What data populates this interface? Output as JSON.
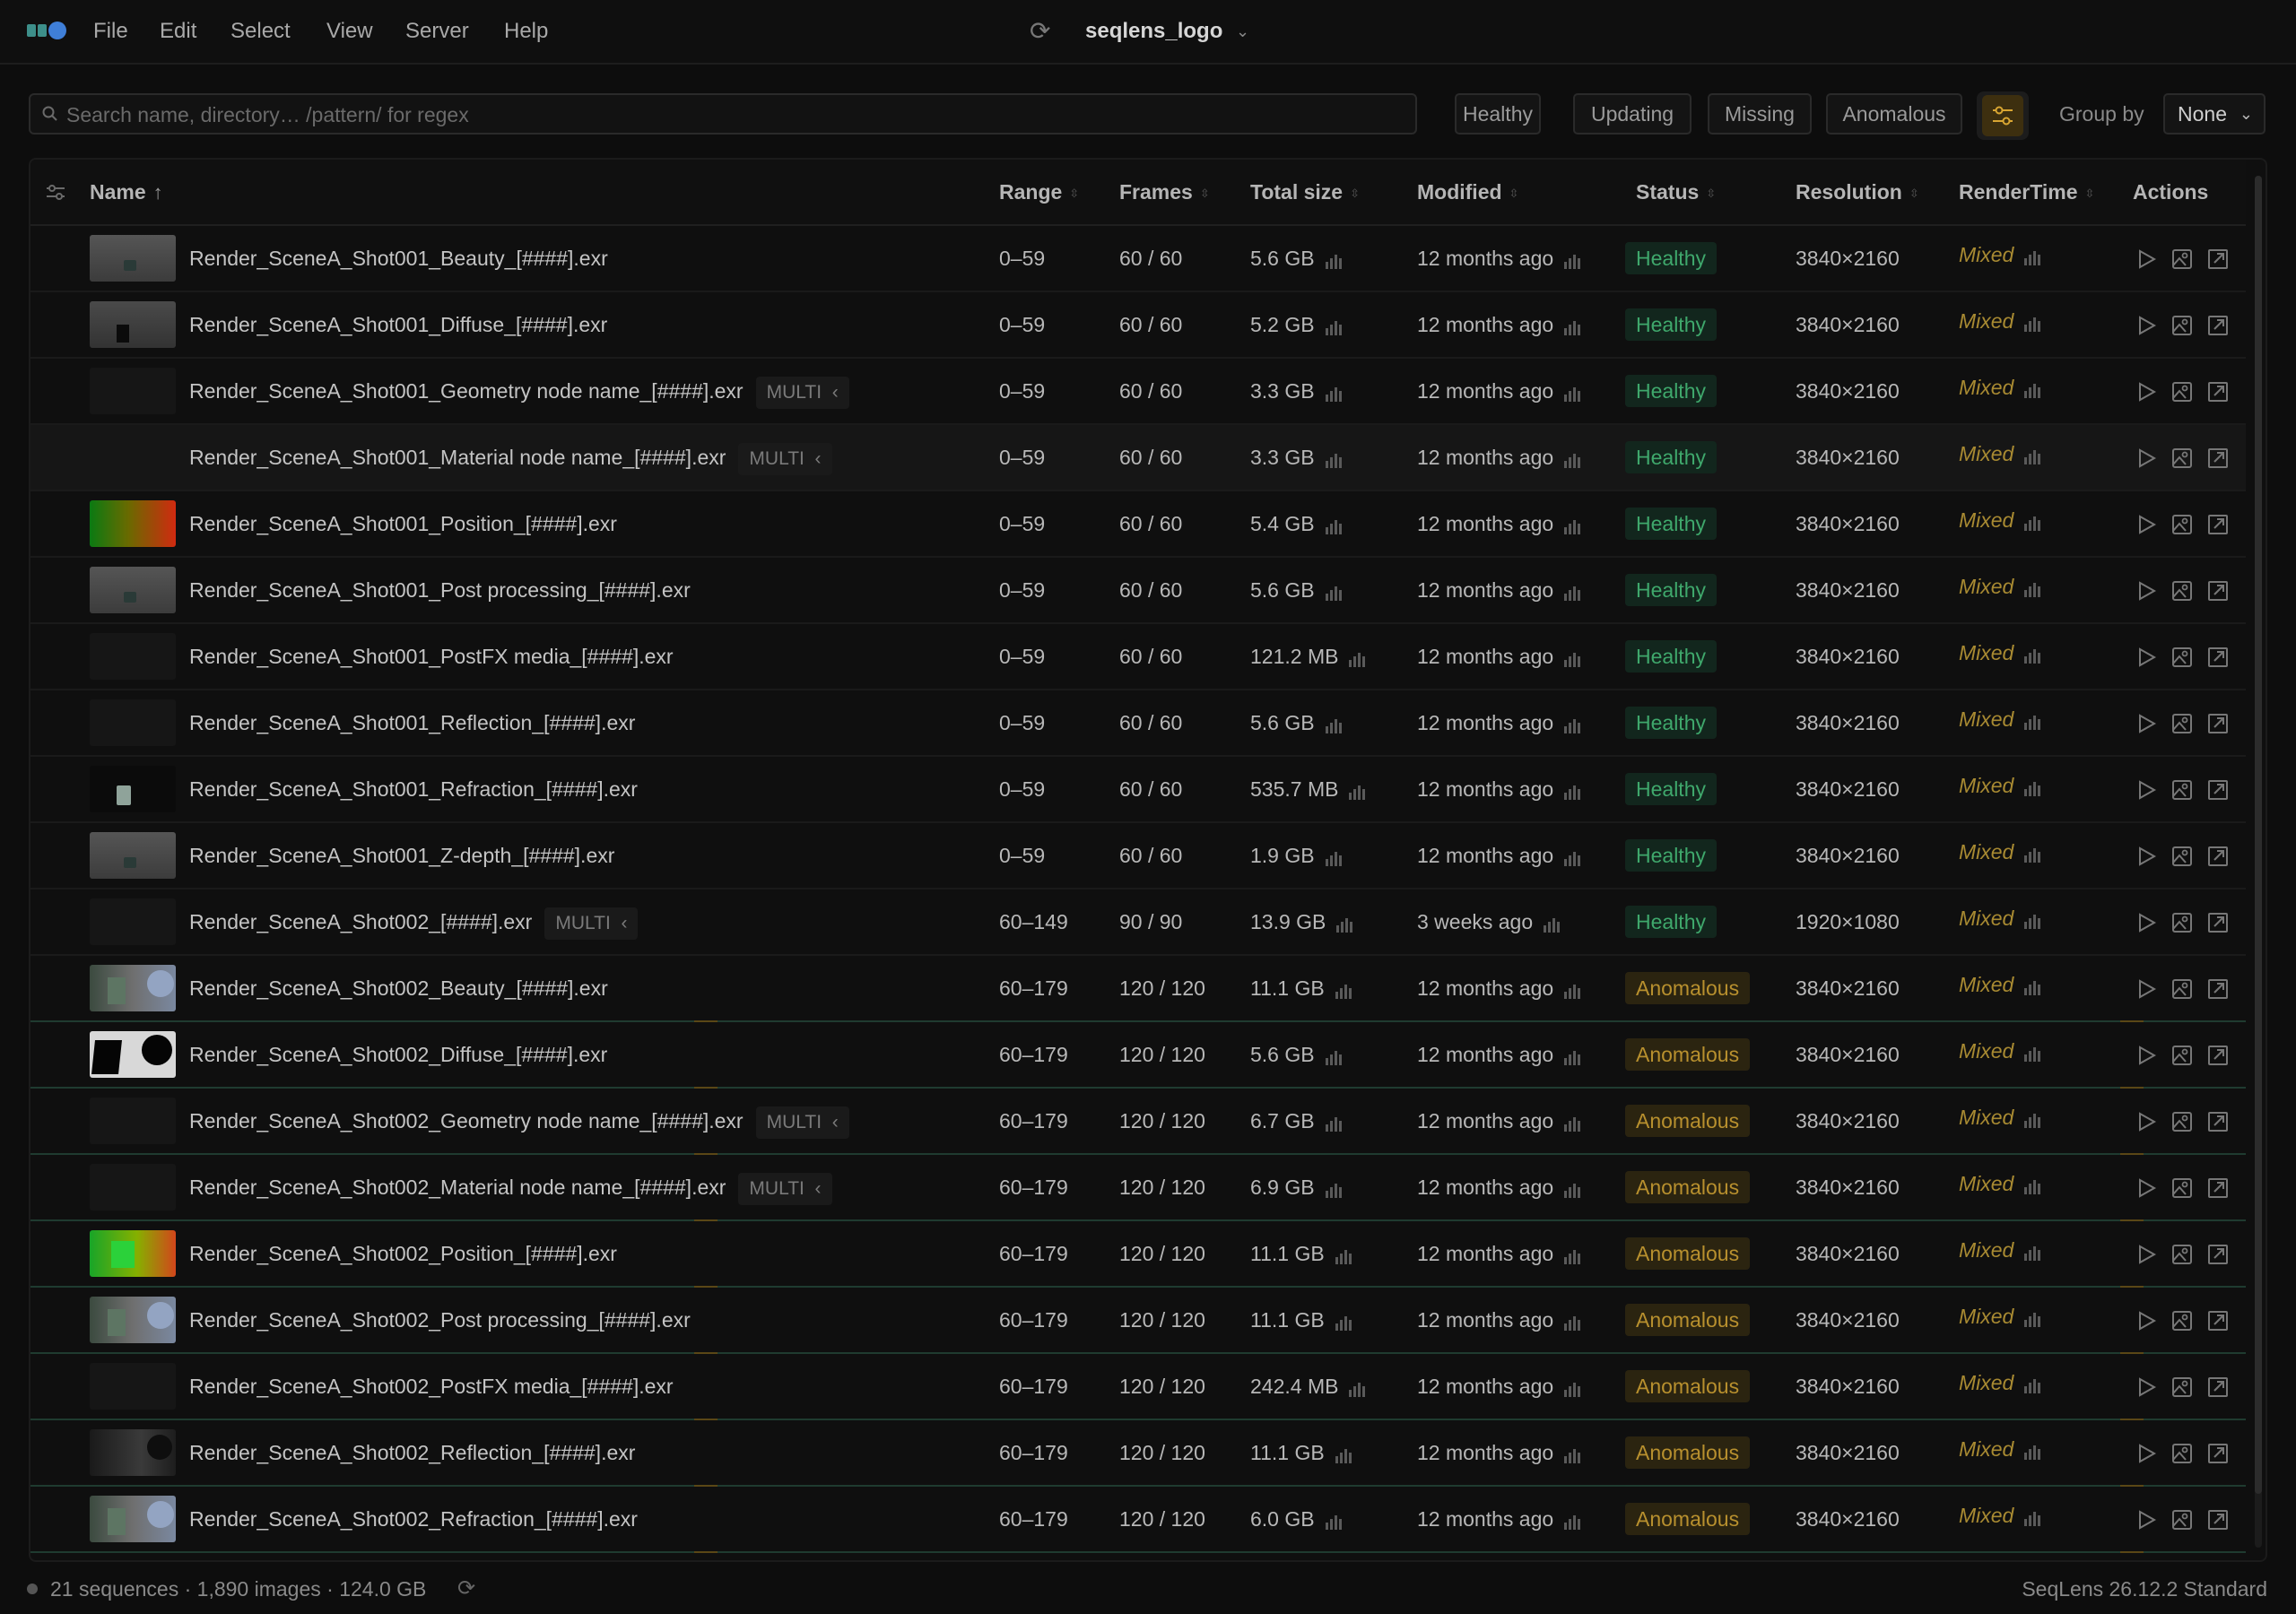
{
  "app": {
    "menu": [
      "File",
      "Edit",
      "Select",
      "View",
      "Server",
      "Help"
    ],
    "project_name": "seqlens_logo"
  },
  "toolbar": {
    "search_placeholder": "Search name, directory… /pattern/ for regex",
    "filters": [
      "Healthy",
      "Updating",
      "Missing",
      "Anomalous"
    ],
    "group_by_label": "Group by",
    "group_by_value": "None"
  },
  "table": {
    "columns": [
      "Name",
      "Range",
      "Frames",
      "Total size",
      "Modified",
      "Status",
      "Resolution",
      "RenderTime",
      "Actions"
    ],
    "rows": [
      {
        "name": "Render_SceneA_Shot001_Beauty_[####].exr",
        "multi": "",
        "range": "0–59",
        "frames": "60 / 60",
        "size": "5.6 GB",
        "modified": "12 months ago",
        "status": "Healthy",
        "resolution": "3840×2160",
        "rendertime": "Mixed",
        "thumb": "grey"
      },
      {
        "name": "Render_SceneA_Shot001_Diffuse_[####].exr",
        "multi": "",
        "range": "0–59",
        "frames": "60 / 60",
        "size": "5.2 GB",
        "modified": "12 months ago",
        "status": "Healthy",
        "resolution": "3840×2160",
        "rendertime": "Mixed",
        "thumb": "grey-dark"
      },
      {
        "name": "Render_SceneA_Shot001_Geometry node name_[####].exr",
        "multi": "MULTI",
        "range": "0–59",
        "frames": "60 / 60",
        "size": "3.3 GB",
        "modified": "12 months ago",
        "status": "Healthy",
        "resolution": "3840×2160",
        "rendertime": "Mixed",
        "thumb": "black"
      },
      {
        "name": "Render_SceneA_Shot001_Material node name_[####].exr",
        "multi": "MULTI",
        "range": "0–59",
        "frames": "60 / 60",
        "size": "3.3 GB",
        "modified": "12 months ago",
        "status": "Healthy",
        "resolution": "3840×2160",
        "rendertime": "Mixed",
        "thumb": "black"
      },
      {
        "name": "Render_SceneA_Shot001_Position_[####].exr",
        "multi": "",
        "range": "0–59",
        "frames": "60 / 60",
        "size": "5.4 GB",
        "modified": "12 months ago",
        "status": "Healthy",
        "resolution": "3840×2160",
        "rendertime": "Mixed",
        "thumb": "position"
      },
      {
        "name": "Render_SceneA_Shot001_Post processing_[####].exr",
        "multi": "",
        "range": "0–59",
        "frames": "60 / 60",
        "size": "5.6 GB",
        "modified": "12 months ago",
        "status": "Healthy",
        "resolution": "3840×2160",
        "rendertime": "Mixed",
        "thumb": "grey"
      },
      {
        "name": "Render_SceneA_Shot001_PostFX media_[####].exr",
        "multi": "",
        "range": "0–59",
        "frames": "60 / 60",
        "size": "121.2 MB",
        "modified": "12 months ago",
        "status": "Healthy",
        "resolution": "3840×2160",
        "rendertime": "Mixed",
        "thumb": "black"
      },
      {
        "name": "Render_SceneA_Shot001_Reflection_[####].exr",
        "multi": "",
        "range": "0–59",
        "frames": "60 / 60",
        "size": "5.6 GB",
        "modified": "12 months ago",
        "status": "Healthy",
        "resolution": "3840×2160",
        "rendertime": "Mixed",
        "thumb": "black"
      },
      {
        "name": "Render_SceneA_Shot001_Refraction_[####].exr",
        "multi": "",
        "range": "0–59",
        "frames": "60 / 60",
        "size": "535.7 MB",
        "modified": "12 months ago",
        "status": "Healthy",
        "resolution": "3840×2160",
        "rendertime": "Mixed",
        "thumb": "refraction"
      },
      {
        "name": "Render_SceneA_Shot001_Z-depth_[####].exr",
        "multi": "",
        "range": "0–59",
        "frames": "60 / 60",
        "size": "1.9 GB",
        "modified": "12 months ago",
        "status": "Healthy",
        "resolution": "3840×2160",
        "rendertime": "Mixed",
        "thumb": "grey"
      },
      {
        "name": "Render_SceneA_Shot002_[####].exr",
        "multi": "MULTI",
        "range": "60–149",
        "frames": "90 / 90",
        "size": "13.9 GB",
        "modified": "3 weeks ago",
        "status": "Healthy",
        "resolution": "1920×1080",
        "rendertime": "Mixed",
        "thumb": "black"
      },
      {
        "name": "Render_SceneA_Shot002_Beauty_[####].exr",
        "multi": "",
        "range": "60–179",
        "frames": "120 / 120",
        "size": "11.1 GB",
        "modified": "12 months ago",
        "status": "Anomalous",
        "resolution": "3840×2160",
        "rendertime": "Mixed",
        "thumb": "scene"
      },
      {
        "name": "Render_SceneA_Shot002_Diffuse_[####].exr",
        "multi": "",
        "range": "60–179",
        "frames": "120 / 120",
        "size": "5.6 GB",
        "modified": "12 months ago",
        "status": "Anomalous",
        "resolution": "3840×2160",
        "rendertime": "Mixed",
        "thumb": "diffuse"
      },
      {
        "name": "Render_SceneA_Shot002_Geometry node name_[####].exr",
        "multi": "MULTI",
        "range": "60–179",
        "frames": "120 / 120",
        "size": "6.7 GB",
        "modified": "12 months ago",
        "status": "Anomalous",
        "resolution": "3840×2160",
        "rendertime": "Mixed",
        "thumb": "black"
      },
      {
        "name": "Render_SceneA_Shot002_Material node name_[####].exr",
        "multi": "MULTI",
        "range": "60–179",
        "frames": "120 / 120",
        "size": "6.9 GB",
        "modified": "12 months ago",
        "status": "Anomalous",
        "resolution": "3840×2160",
        "rendertime": "Mixed",
        "thumb": "black"
      },
      {
        "name": "Render_SceneA_Shot002_Position_[####].exr",
        "multi": "",
        "range": "60–179",
        "frames": "120 / 120",
        "size": "11.1 GB",
        "modified": "12 months ago",
        "status": "Anomalous",
        "resolution": "3840×2160",
        "rendertime": "Mixed",
        "thumb": "position2"
      },
      {
        "name": "Render_SceneA_Shot002_Post processing_[####].exr",
        "multi": "",
        "range": "60–179",
        "frames": "120 / 120",
        "size": "11.1 GB",
        "modified": "12 months ago",
        "status": "Anomalous",
        "resolution": "3840×2160",
        "rendertime": "Mixed",
        "thumb": "scene"
      },
      {
        "name": "Render_SceneA_Shot002_PostFX media_[####].exr",
        "multi": "",
        "range": "60–179",
        "frames": "120 / 120",
        "size": "242.4 MB",
        "modified": "12 months ago",
        "status": "Anomalous",
        "resolution": "3840×2160",
        "rendertime": "Mixed",
        "thumb": "black"
      },
      {
        "name": "Render_SceneA_Shot002_Reflection_[####].exr",
        "multi": "",
        "range": "60–179",
        "frames": "120 / 120",
        "size": "11.1 GB",
        "modified": "12 months ago",
        "status": "Anomalous",
        "resolution": "3840×2160",
        "rendertime": "Mixed",
        "thumb": "reflection"
      },
      {
        "name": "Render_SceneA_Shot002_Refraction_[####].exr",
        "multi": "",
        "range": "60–179",
        "frames": "120 / 120",
        "size": "6.0 GB",
        "modified": "12 months ago",
        "status": "Anomalous",
        "resolution": "3840×2160",
        "rendertime": "Mixed",
        "thumb": "scene"
      }
    ]
  },
  "statusbar": {
    "summary": "21 sequences · 1,890 images · 124.0 GB",
    "version": "SeqLens 26.12.2 Standard"
  },
  "colors": {
    "healthy": "#3fa86c",
    "anomalous": "#b8902e",
    "mixed": "#a88a32",
    "accent_filter": "#d9a632"
  },
  "icons": {
    "row_actions": [
      "play-icon",
      "image-icon",
      "open-external-icon"
    ],
    "filter_settings": "sliders-icon",
    "search": "search-icon",
    "refresh": "refresh-icon"
  }
}
